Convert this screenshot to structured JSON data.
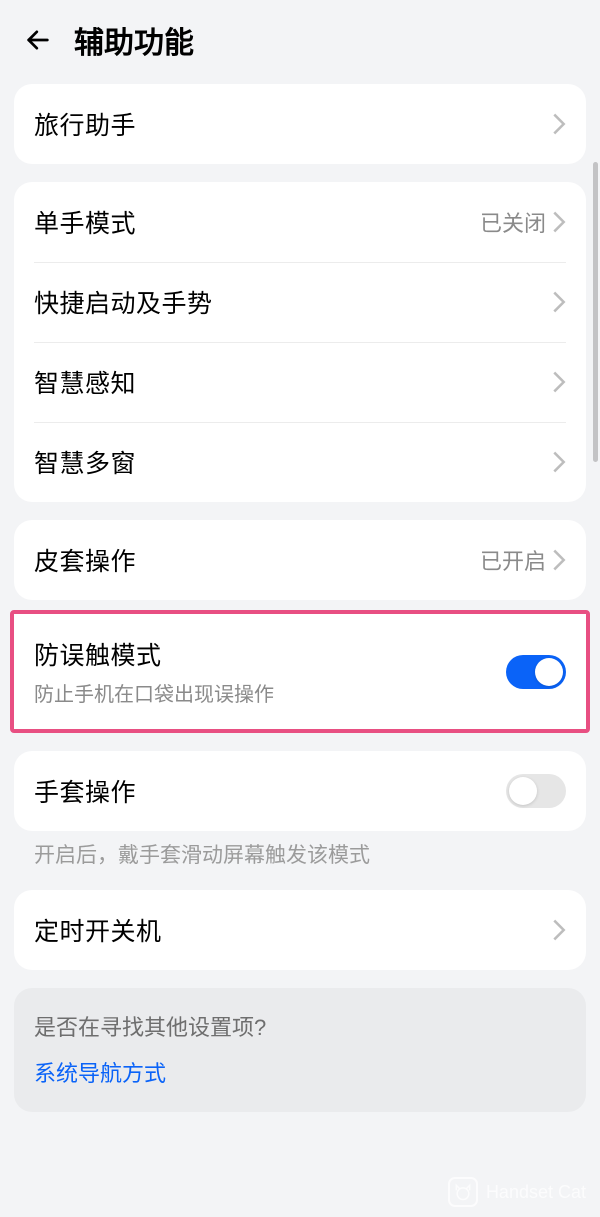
{
  "header": {
    "title": "辅助功能"
  },
  "groups": {
    "g1": [
      {
        "label": "旅行助手"
      }
    ],
    "g2": [
      {
        "label": "单手模式",
        "value": "已关闭"
      },
      {
        "label": "快捷启动及手势"
      },
      {
        "label": "智慧感知"
      },
      {
        "label": "智慧多窗"
      }
    ],
    "g3_top": {
      "label": "皮套操作",
      "value": "已开启"
    },
    "highlight": {
      "label": "防误触模式",
      "sub": "防止手机在口袋出现误操作",
      "toggle": true
    },
    "g4": {
      "label": "手套操作",
      "toggle": false
    },
    "g4_desc": "开启后，戴手套滑动屏幕触发该模式",
    "g5": [
      {
        "label": "定时开关机"
      }
    ],
    "search": {
      "question": "是否在寻找其他设置项?",
      "link": "系统导航方式"
    }
  },
  "watermark": "Handset Cat"
}
